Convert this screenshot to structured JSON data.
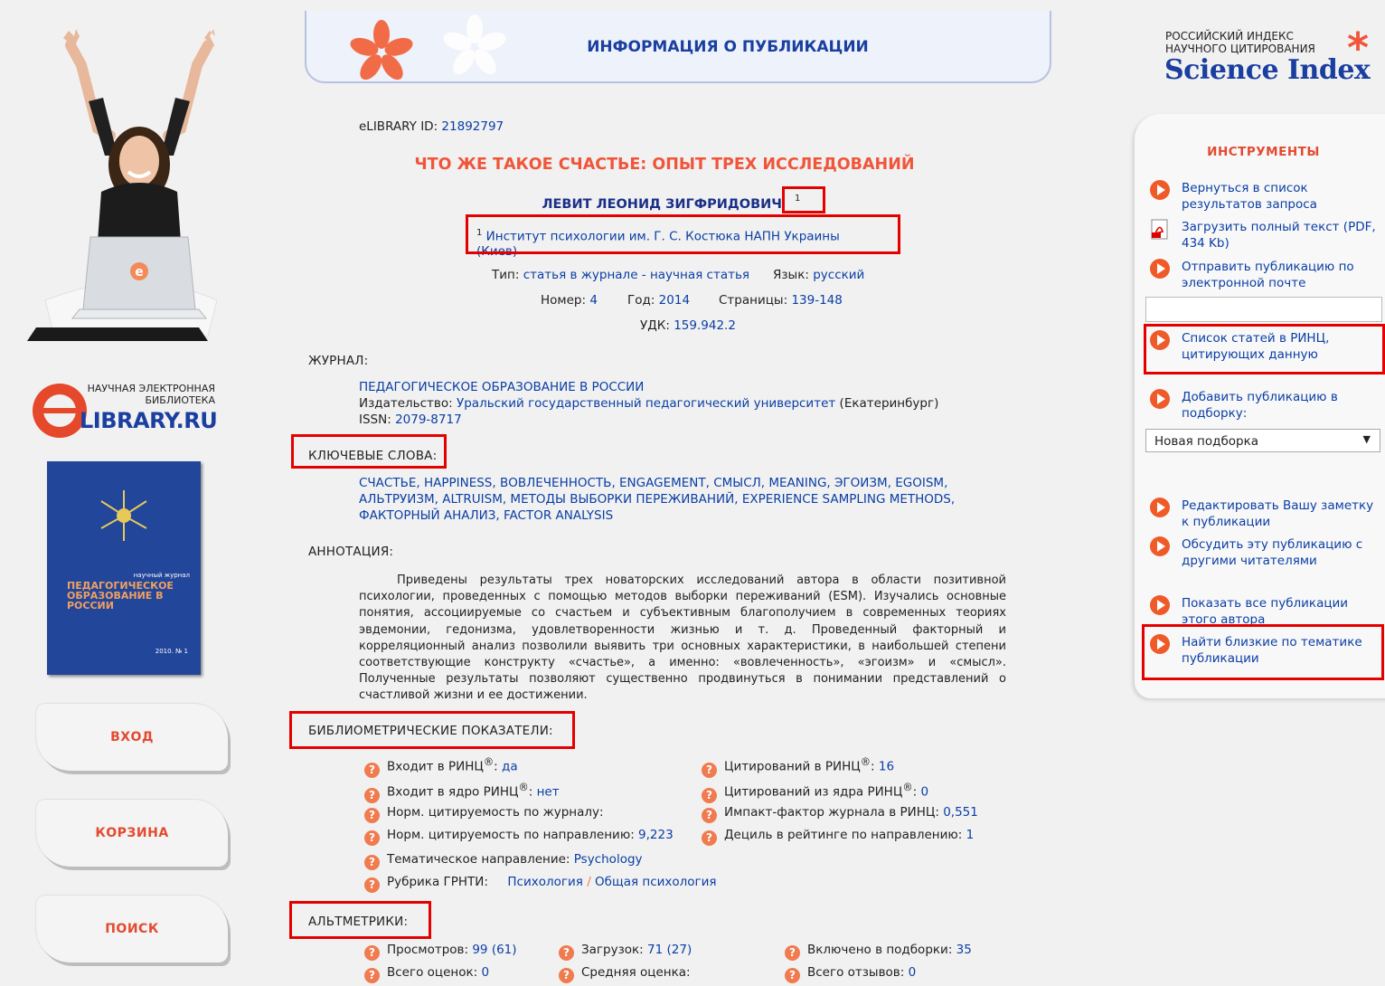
{
  "header": {
    "title": "ИНФОРМАЦИЯ О ПУБЛИКАЦИИ"
  },
  "brand": {
    "elibrary_line1": "НАУЧНАЯ ЭЛЕКТРОННАЯ",
    "elibrary_line2": "БИБЛИОТЕКА",
    "elibrary_logo": "LIBRARY.RU",
    "elibrary_e": "e",
    "science_index_line1": "РОССИЙСКИЙ ИНДЕКС",
    "science_index_line2": "НАУЧНОГО ЦИТИРОВАНИЯ",
    "science_index_title": "Science Index",
    "cover_small": "научный журнал",
    "cover_title": "ПЕДАГОГИЧЕСКОЕ ОБРАЗОВАНИЕ В РОССИИ",
    "cover_year": "2010. № 1",
    "laptop_e": "e"
  },
  "nav": {
    "login": "ВХОД",
    "cart": "КОРЗИНА",
    "search": "ПОИСК"
  },
  "publication": {
    "id_label": "eLIBRARY ID:",
    "id_value": "21892797",
    "title": "ЧТО ЖЕ ТАКОЕ СЧАСТЬЕ: ОПЫТ ТРЕХ ИССЛЕДОВАНИЙ",
    "author": "ЛЕВИТ ЛЕОНИД ЗИГФРИДОВИЧ",
    "author_sup": "1",
    "affiliation_sup": "1",
    "affiliation": "Институт психологии им. Г. С. Костюка НАПН Украины (Киев)",
    "type_label": "Тип:",
    "type_value": "статья в журнале - научная статья",
    "lang_label": "Язык:",
    "lang_value": "русский",
    "number_label": "Номер:",
    "number_value": "4",
    "year_label": "Год:",
    "year_value": "2014",
    "pages_label": "Страницы:",
    "pages_value": "139-148",
    "udk_label": "УДК:",
    "udk_value": "159.942.2"
  },
  "journal": {
    "section": "ЖУРНАЛ:",
    "name": "ПЕДАГОГИЧЕСКОЕ ОБРАЗОВАНИЕ В РОССИИ",
    "publisher_label": "Издательство:",
    "publisher": "Уральский государственный педагогический университет",
    "publisher_city": "(Екатеринбург)",
    "issn_label": "ISSN:",
    "issn": "2079-8717"
  },
  "keywords": {
    "section": "КЛЮЧЕВЫЕ СЛОВА:",
    "line1": "СЧАСТЬЕ, HAPPINESS, ВОВЛЕЧЕННОСТЬ, ENGAGEMENT, СМЫСЛ, MEANING, ЭГОИЗМ, EGOISM,",
    "line2": "АЛЬТРУИЗМ, ALTRUISM, МЕТОДЫ ВЫБОРКИ ПЕРЕЖИВАНИЙ, EXPERIENCE SAMPLING METHODS,",
    "line3": "ФАКТОРНЫЙ АНАЛИЗ, FACTOR ANALYSIS"
  },
  "annotation": {
    "section": "АННОТАЦИЯ:",
    "text": "Приведены результаты трех новаторских исследований автора в области позитивной психологии, проведенных с помощью методов выборки переживаний (ESM). Изучались основные понятия, ассоциируемые со счастьем и субъективным благополучием в современных теориях эвдемонии, гедонизма, удовлетворенности жизнью и т. д. Проведенный факторный и корреляционный анализ позволили выявить три основных характеристики, в наибольшей степени соответствующие конструкту «счастье», а именно: «вовлеченность», «эгоизм» и «смысл». Полученные результаты позволяют существенно продвинуться в понимании представлений о счастливой жизни и ее достижении."
  },
  "biblio": {
    "section": "БИБЛИОМЕТРИЧЕСКИЕ ПОКАЗАТЕЛИ:",
    "rinc_label": "Входит в РИНЦ",
    "rinc_value": "да",
    "core_label": "Входит в ядро РИНЦ",
    "core_value": "нет",
    "norm_journal_label": "Норм. цитируемость по журналу:",
    "norm_dir_label": "Норм. цитируемость по направлению:",
    "norm_dir_value": "9,223",
    "topic_label": "Тематическое направление:",
    "topic_value": "Psychology",
    "grnti_label": "Рубрика ГРНТИ:",
    "grnti_value1": "Психология",
    "grnti_sep": "/",
    "grnti_value2": "Общая психология",
    "cit_label": "Цитирований в РИНЦ",
    "cit_value": "16",
    "cit_core_label": "Цитирований из ядра РИНЦ",
    "cit_core_value": "0",
    "impact_label": "Импакт-фактор журнала в РИНЦ:",
    "impact_value": "0,551",
    "decile_label": "Дециль в рейтинге по направлению:",
    "decile_value": "1",
    "reg": "®",
    "colon": ":"
  },
  "altmetrics": {
    "section": "АЛЬТМЕТРИКИ:",
    "views_label": "Просмотров:",
    "views_value": "99 (61)",
    "downloads_label": "Загрузок:",
    "downloads_value": "71 (27)",
    "collections_label": "Включено в подборки:",
    "collections_value": "35",
    "ratings_label": "Всего оценок:",
    "ratings_value": "0",
    "avg_label": "Средняя оценка:",
    "reviews_label": "Всего отзывов:",
    "reviews_value": "0"
  },
  "tools": {
    "title": "ИНСТРУМЕНТЫ",
    "back": "Вернуться в список результатов запроса",
    "download": "Загрузить полный текст (PDF, 434 Kb)",
    "email": "Отправить публикацию по электронной почте",
    "citing": "Список статей в РИНЦ, цитирующих данную",
    "add": "Добавить публикацию в подборку:",
    "collection_select": "Новая подборка",
    "edit_note": "Редактировать Вашу заметку к публикации",
    "discuss": "Обсудить эту публикацию с другими читателями",
    "author_pubs": "Показать все публикации этого автора",
    "similar": "Найти близкие по тематике публикации"
  }
}
